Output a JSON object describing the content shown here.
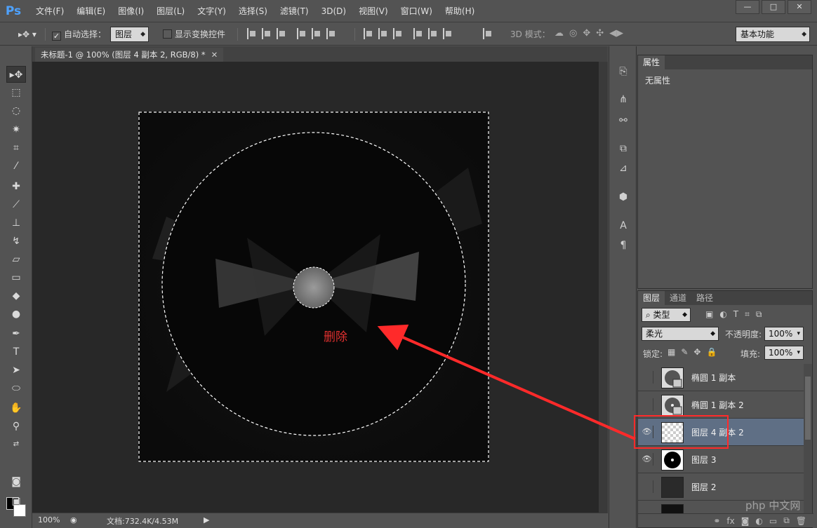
{
  "app": {
    "logo": "Ps"
  },
  "menu": [
    "文件(F)",
    "编辑(E)",
    "图像(I)",
    "图层(L)",
    "文字(Y)",
    "选择(S)",
    "滤镜(T)",
    "3D(D)",
    "视图(V)",
    "窗口(W)",
    "帮助(H)"
  ],
  "window_controls": {
    "minimize": "—",
    "maximize": "□",
    "close": "✕"
  },
  "options": {
    "auto_select_label": "自动选择：",
    "auto_select_checked": "✓",
    "auto_select_target": "图层",
    "show_transform_label": "显示变换控件",
    "mode_3d_label": "3D 模式：",
    "workspace": "基本功能"
  },
  "document": {
    "tab_title": "未标题-1 @ 100% (图层 4 副本 2, RGB/8) *",
    "tab_close": "✕"
  },
  "status": {
    "zoom": "100%",
    "doc_size": "文档:732.4K/4.53M"
  },
  "properties": {
    "tab": "属性",
    "body_title": "无属性"
  },
  "layers_panel": {
    "tabs": [
      "图层",
      "通道",
      "路径"
    ],
    "filter_kind": "类型",
    "blend_mode": "柔光",
    "opacity_label": "不透明度:",
    "opacity_value": "100%",
    "lock_label": "锁定:",
    "fill_label": "填充:",
    "fill_value": "100%",
    "layers": [
      {
        "name": "椭圆 1 副本",
        "visible": false,
        "selected": false
      },
      {
        "name": "椭圆 1 副本 2",
        "visible": false,
        "selected": false
      },
      {
        "name": "图层 4 副本 2",
        "visible": true,
        "selected": true
      },
      {
        "name": "图层 3",
        "visible": true,
        "selected": false
      },
      {
        "name": "图层 2",
        "visible": false,
        "selected": false
      }
    ],
    "footer_icons": [
      "link-icon",
      "fx-icon",
      "mask-icon",
      "adjustment-icon",
      "group-icon",
      "new-layer-icon",
      "trash-icon"
    ]
  },
  "annotation": {
    "text": "删除",
    "color": "#e0302f"
  },
  "watermark": "php 中文网",
  "colors": {
    "selected_layer": "#5f6f85",
    "panel": "#535353",
    "canvas_bg": "#282828",
    "annotation": "#ff2a2a"
  }
}
